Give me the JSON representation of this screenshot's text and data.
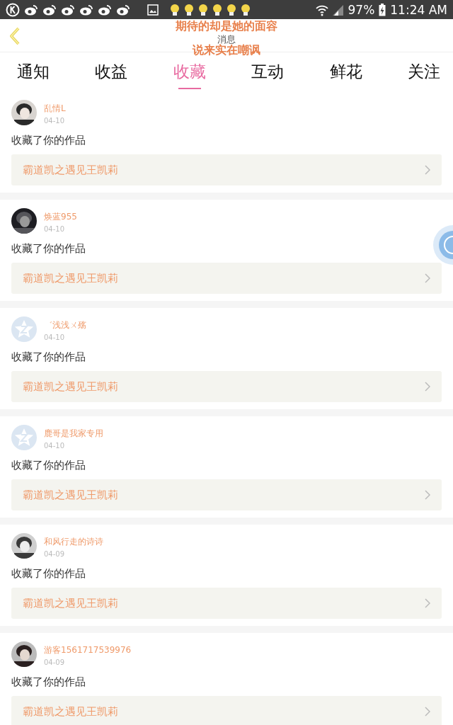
{
  "status_bar": {
    "battery": "97%",
    "time": "11:24 AM"
  },
  "header": {
    "title": "消息"
  },
  "lyrics_overlay": [
    "期待的却是她的面容",
    "说来实在嘲讽"
  ],
  "tabs": [
    {
      "label": "通知",
      "selected": false
    },
    {
      "label": "收益",
      "selected": false
    },
    {
      "label": "收藏",
      "selected": true
    },
    {
      "label": "互动",
      "selected": false
    },
    {
      "label": "鲜花",
      "selected": false
    },
    {
      "label": "关注",
      "selected": false
    }
  ],
  "notifications": [
    {
      "kind": "picture",
      "user": "乱情L",
      "date": "04-10",
      "message": "收藏了你的作品",
      "work": "霸道凯之遇见王凯莉"
    },
    {
      "kind": "picture",
      "user": "焕蓝955",
      "date": "04-10",
      "message": "收藏了你的作品",
      "work": "霸道凯之遇见王凯莉"
    },
    {
      "kind": "default",
      "user": "゛浅浅ㄨ殇",
      "date": "04-10",
      "message": "收藏了你的作品",
      "work": "霸道凯之遇见王凯莉"
    },
    {
      "kind": "default",
      "user": "鹿哥是我家专用",
      "date": "04-10",
      "message": "收藏了你的作品",
      "work": "霸道凯之遇见王凯莉"
    },
    {
      "kind": "picture",
      "user": "和风行走的诗诗",
      "date": "04-09",
      "message": "收藏了你的作品",
      "work": "霸道凯之遇见王凯莉"
    },
    {
      "kind": "picture",
      "user": "游客1561717539976",
      "date": "04-09",
      "message": "收藏了你的作品",
      "work": "霸道凯之遇见王凯莉"
    }
  ]
}
